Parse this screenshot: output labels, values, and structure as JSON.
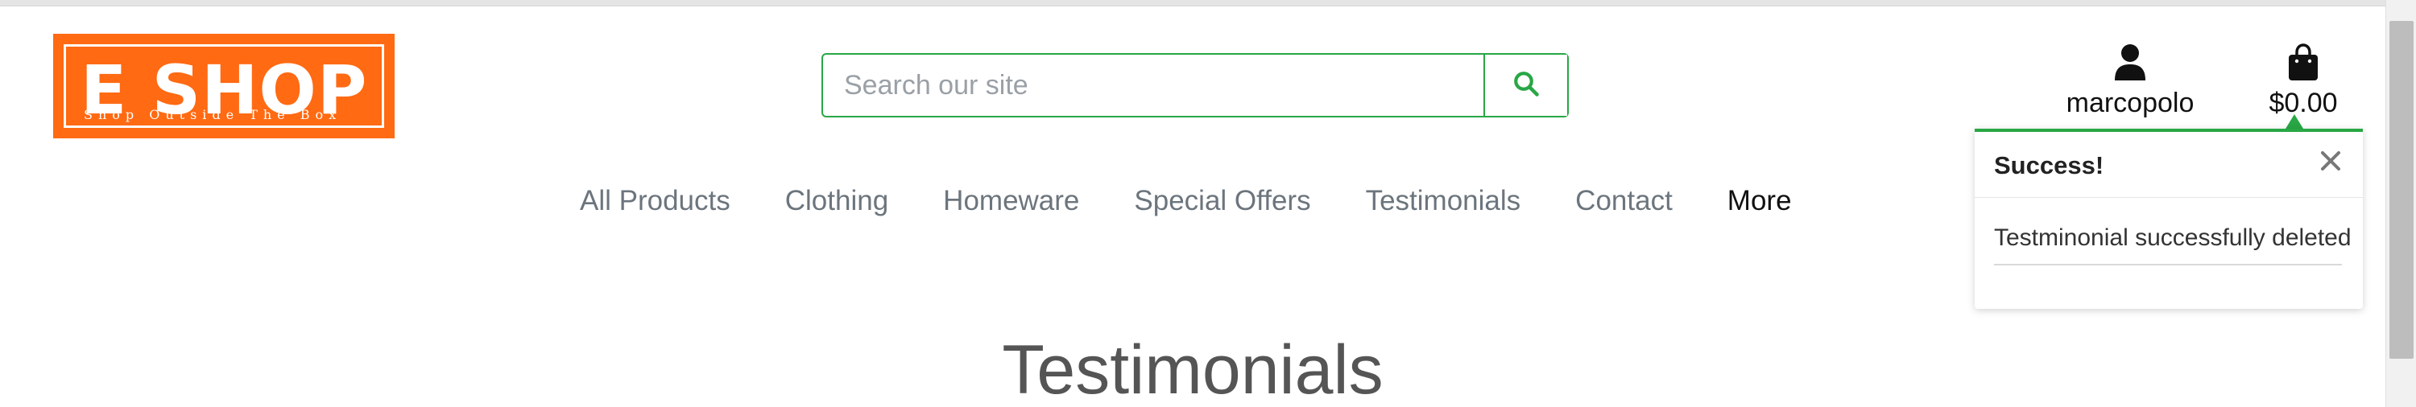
{
  "logo": {
    "title": "E SHOP",
    "tagline": "Shop Outside The Box"
  },
  "search": {
    "placeholder": "Search our site",
    "value": "",
    "icon": "search-icon"
  },
  "account": {
    "username": "marcopolo",
    "icon": "user-icon"
  },
  "cart": {
    "total": "$0.00",
    "icon": "shopping-bag-icon"
  },
  "nav": {
    "items": [
      {
        "label": "All Products"
      },
      {
        "label": "Clothing"
      },
      {
        "label": "Homeware"
      },
      {
        "label": "Special Offers"
      },
      {
        "label": "Testimonials"
      },
      {
        "label": "Contact"
      },
      {
        "label": "More"
      }
    ]
  },
  "page": {
    "title": "Testimonials"
  },
  "toast": {
    "title": "Success!",
    "message": "Testminonial successfully deleted",
    "close_icon": "close-icon"
  },
  "colors": {
    "brand": "#ff6a13",
    "accent": "#28a745",
    "text": "#555555"
  }
}
